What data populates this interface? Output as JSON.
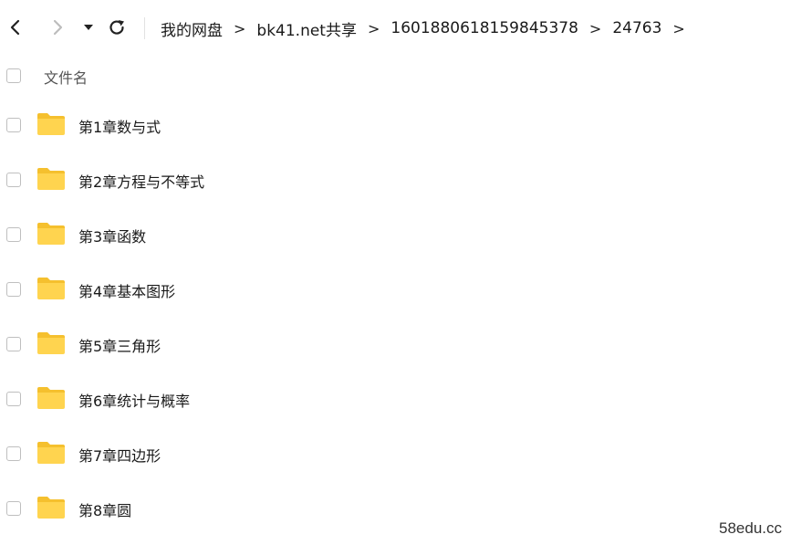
{
  "toolbar": {
    "back_icon": "chevron-left-icon",
    "forward_icon": "chevron-right-icon",
    "dropdown_icon": "caret-down-icon",
    "refresh_icon": "refresh-icon"
  },
  "breadcrumb": [
    {
      "label": "我的网盘"
    },
    {
      "label": "bk41.net共享"
    },
    {
      "label": "1601880618159845378"
    },
    {
      "label": "24763"
    }
  ],
  "list": {
    "header": "文件名",
    "items": [
      {
        "name": "第1章数与式"
      },
      {
        "name": "第2章方程与不等式"
      },
      {
        "name": "第3章函数"
      },
      {
        "name": "第4章基本图形"
      },
      {
        "name": "第5章三角形"
      },
      {
        "name": "第6章统计与概率"
      },
      {
        "name": "第7章四边形"
      },
      {
        "name": "第8章圆"
      }
    ]
  },
  "colors": {
    "folder": "#FFD44F",
    "folder_tab": "#F5C02E"
  },
  "watermark": "58edu.cc"
}
